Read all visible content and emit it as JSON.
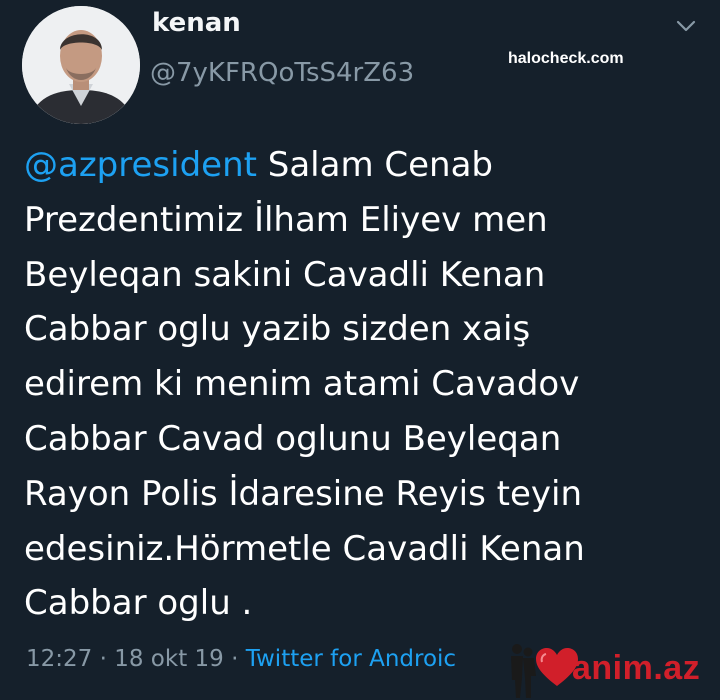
{
  "user": {
    "display_name": "kenan",
    "handle": "@7yKFRQoTsS4rZ63"
  },
  "tweet": {
    "mention": "@azpresident",
    "body": " Salam Cenab\nPrezdentimiz İlham Eliyev men\nBeyleqan sakini Cavadli Kenan\nCabbar oglu yazib sizden xaiş\nedirem ki menim atami Cavadov\nCabbar Cavad oglunu Beyleqan\nRayon Polis İdaresine Reyis teyin\nedesiniz.Hörmetle Cavadli Kenan\nCabbar oglu ."
  },
  "meta": {
    "time": "12:27",
    "separator1": " · ",
    "date": "18 okt 19",
    "separator2": " · ",
    "source": "Twitter for Androic"
  },
  "watermarks": {
    "top_right": "halocheck.com",
    "bottom_logo": "anim.az"
  },
  "icons": {
    "caret": "chevron-down-icon",
    "avatar": "profile-photo"
  },
  "colors": {
    "background": "#15202b",
    "text": "#ffffff",
    "secondary": "#8899a6",
    "link": "#1da1f2",
    "brand": "#d11f2a"
  }
}
